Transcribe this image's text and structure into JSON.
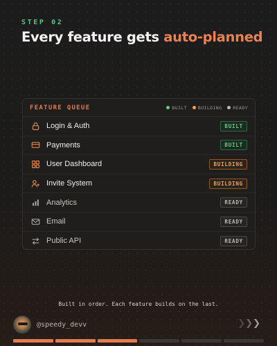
{
  "header": {
    "step": "STEP 02",
    "title_prefix": "Every feature gets ",
    "title_accent": "auto-planned"
  },
  "card": {
    "title": "FEATURE QUEUE",
    "legend": [
      {
        "label": "BUILT",
        "color": "#5fcf86"
      },
      {
        "label": "BUILDING",
        "color": "#f2a158"
      },
      {
        "label": "READY",
        "color": "#bdb9b2"
      }
    ],
    "features": [
      {
        "name": "Login & Auth",
        "icon": "lock-icon",
        "status": "BUILT"
      },
      {
        "name": "Payments",
        "icon": "credit-card-icon",
        "status": "BUILT"
      },
      {
        "name": "User Dashboard",
        "icon": "grid-icon",
        "status": "BUILDING"
      },
      {
        "name": "Invite System",
        "icon": "user-plus-icon",
        "status": "BUILDING"
      },
      {
        "name": "Analytics",
        "icon": "bar-chart-icon",
        "status": "READY"
      },
      {
        "name": "Email",
        "icon": "mail-icon",
        "status": "READY"
      },
      {
        "name": "Public API",
        "icon": "swap-arrows-icon",
        "status": "READY"
      }
    ]
  },
  "footer": {
    "caption": "Built in order. Each feature builds on the last.",
    "handle": "@speedy_devv",
    "progress": {
      "segments": 6,
      "filled": 3
    },
    "accent_color": "#e27c4e"
  }
}
